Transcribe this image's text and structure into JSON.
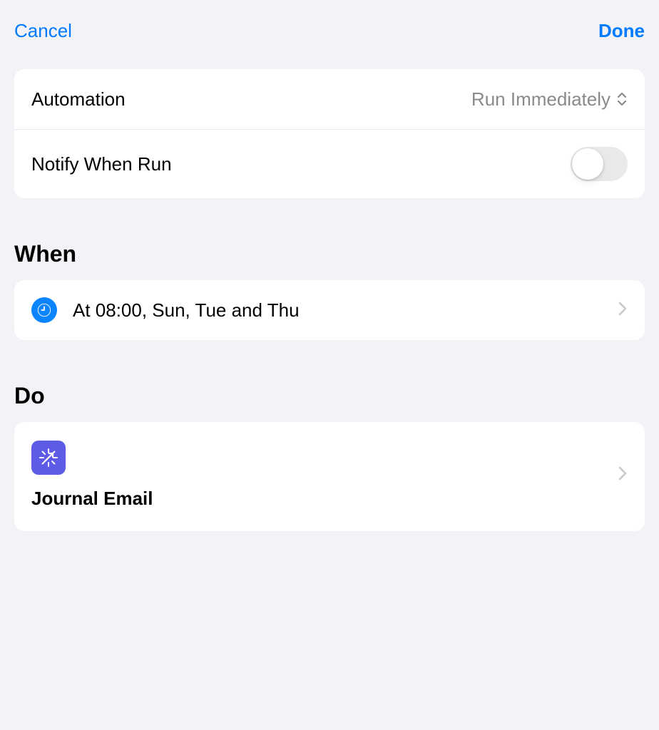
{
  "header": {
    "cancel_label": "Cancel",
    "done_label": "Done"
  },
  "settings": {
    "automation_label": "Automation",
    "automation_value": "Run Immediately",
    "notify_label": "Notify When Run",
    "notify_enabled": false
  },
  "when": {
    "heading": "When",
    "trigger_text": "At 08:00, Sun, Tue and Thu"
  },
  "do": {
    "heading": "Do",
    "shortcut_name": "Journal Email"
  }
}
